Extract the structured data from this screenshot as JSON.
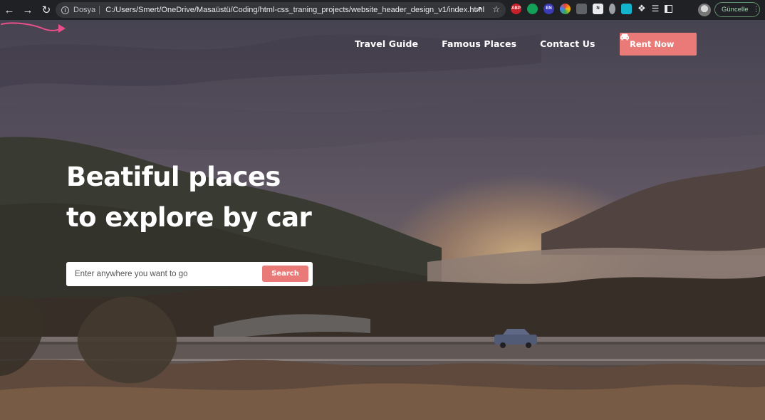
{
  "browser": {
    "scheme_label": "Dosya",
    "url": "C:/Users/Smert/OneDrive/Masaüstü/Coding/html-css_traning_projects/website_header_design_v1/index.html",
    "update_label": "Güncelle",
    "extensions": [
      {
        "name": "abp",
        "label": "ABP",
        "color": "#c7202a"
      },
      {
        "name": "grammarly",
        "label": "",
        "color": "#15a05a"
      },
      {
        "name": "en",
        "label": "EN",
        "color": "#3b3bb8"
      },
      {
        "name": "colorzilla",
        "label": "",
        "color": "#e8a33a"
      },
      {
        "name": "shield",
        "label": "",
        "color": "#5f6368"
      },
      {
        "name": "notion",
        "label": "N",
        "color": "#e8eaed"
      },
      {
        "name": "flask",
        "label": "",
        "color": "#9aa0a6"
      },
      {
        "name": "pen",
        "label": "",
        "color": "#12b5cb"
      }
    ]
  },
  "header": {
    "nav": [
      "Travel Guide",
      "Famous Places",
      "Contact Us"
    ],
    "cta_label": "Rent Now",
    "accent": "#e97a78"
  },
  "hero": {
    "line1": "Beatiful places",
    "line2": "to explore by car",
    "search_placeholder": "Enter anywhere you want to go",
    "search_button": "Search"
  }
}
